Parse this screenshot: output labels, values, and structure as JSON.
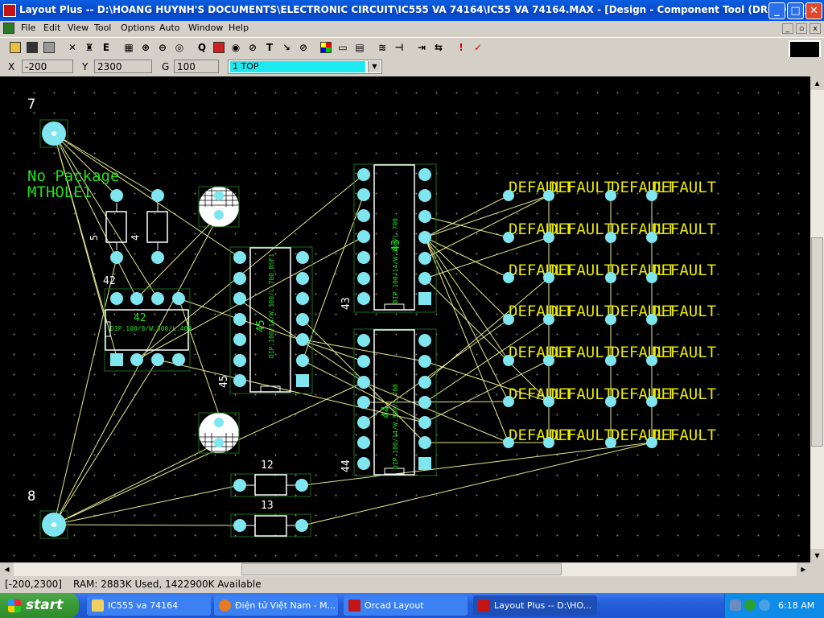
{
  "window": {
    "title": "Layout Plus -- D:\\HOANG HUYNH'S DOCUMENTS\\ELECTRONIC CIRCUIT\\IC555 VA 74164\\IC55 VA 74164.MAX - [Design - Component Tool (DRC OFF)]",
    "minimize": "_",
    "maximize": "□",
    "close": "✕"
  },
  "menu": [
    "File",
    "Edit",
    "View",
    "Tool",
    "Options",
    "Auto",
    "Window",
    "Help"
  ],
  "toolbar": {
    "icons": [
      "open-icon",
      "save-icon",
      "print-icon",
      "delete-icon",
      "find-icon",
      "edit-icon",
      "spreadsheet-icon",
      "zoom-in-icon",
      "zoom-out-icon",
      "zoom-all-icon",
      "query-icon",
      "layer-icon",
      "component-icon",
      "pin-icon",
      "obstacle-icon",
      "text-icon",
      "connection-icon",
      "error-icon",
      "color-icon",
      "drc-icon",
      "route-icon",
      "layer-stack-icon",
      "reconnect-icon",
      "autoroute-icon",
      "flip-icon",
      "rotate-icon",
      "drc-run-icon",
      "drc-check-icon"
    ]
  },
  "coords": {
    "x_label": "X",
    "x_value": "-200",
    "y_label": "Y",
    "y_value": "2300",
    "g_label": "G",
    "g_value": "100",
    "layer": "1  TOP"
  },
  "canvas": {
    "labels": {
      "ref7": "7",
      "ref8": "8",
      "no_package": "No Package",
      "mthole": "MTHOLE1",
      "ref42": "42",
      "ref43": "43",
      "ref44": "44",
      "ref45": "45",
      "ref12": "12",
      "ref13": "13",
      "r5": "5",
      "r4": "4",
      "u42_name": "42",
      "u42_pkg": "DIP.100/8/W.300/L.400",
      "u45_name": "45",
      "u45_pkg": "DIP.100/14/W.300/L.700_BSF1",
      "u43_name": "43",
      "u43_pkg": "DIP.100/14/W.300/L.700",
      "u44_name": "44",
      "u44_pkg": "DIP.100/14/W.300/L.700",
      "default": "DEFAULT"
    }
  },
  "status": {
    "coords": "[-200,2300]",
    "memory": "RAM: 2883K Used, 1422900K Available"
  },
  "taskbar": {
    "start": "start",
    "tasks": [
      "IC555 va 74164",
      "Điện tử Việt Nam - M...",
      "Orcad Layout",
      "Layout Plus -- D:\\HO..."
    ],
    "time": "6:18 AM"
  },
  "colors": {
    "pad": "#7fe6f0",
    "silk": "#ffffff",
    "refdes_green": "#22dd22",
    "default_text": "#e8e800",
    "ratsnest": "#e8e890",
    "canvas": "#000000"
  }
}
